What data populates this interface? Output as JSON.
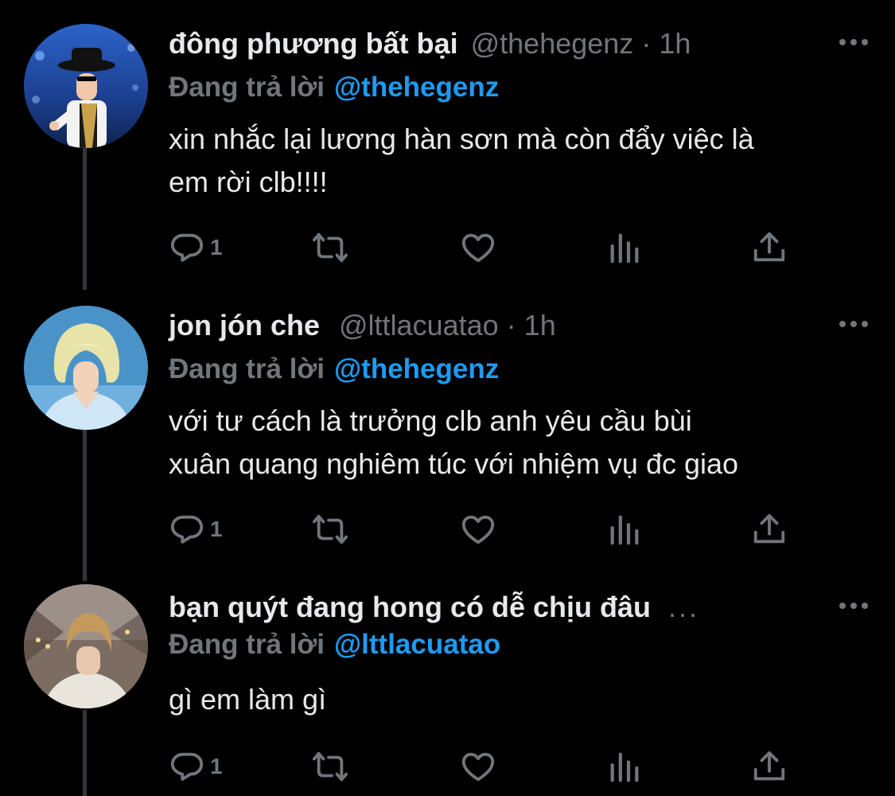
{
  "colors": {
    "background": "#000000",
    "text": "#e7e9ea",
    "muted": "#71767b",
    "accent": "#1d9bf0",
    "thread_line": "#333639"
  },
  "tweets": [
    {
      "name": "đông phương bất bại",
      "name_truncated": false,
      "handle": "@thehegenz",
      "separator": "·",
      "time": "1h",
      "replying_label": "Đang trả lời",
      "replying_to": "@thehegenz",
      "body_lines": [
        "xin nhắc lại lương hàn sơn mà còn đẩy việc là",
        "em rời clb!!!!"
      ],
      "reply_count": "1",
      "avatar_icon": "avatar-blue-stage-performer",
      "more_icon": "more-horizontal-icon"
    },
    {
      "name": "jon jón che",
      "name_truncated": false,
      "handle": "@lttlacuatao",
      "separator": "·",
      "time": "1h",
      "replying_label": "Đang trả lời",
      "replying_to": "@thehegenz",
      "body_lines": [
        "với tư cách là trưởng clb anh yêu cầu bùi",
        "xuân quang nghiêm túc với nhiệm vụ đc giao"
      ],
      "reply_count": "1",
      "avatar_icon": "avatar-blonde-light-blue",
      "more_icon": "more-horizontal-icon"
    },
    {
      "name": "bạn quýt đang hong có dễ chịu đâu",
      "name_truncated": true,
      "name_ellipsis": "...",
      "handle": "",
      "separator": "",
      "time": "",
      "replying_label": "Đang trả lời",
      "replying_to": "@lttlacuatao",
      "body_lines": [
        "gì em làm gì"
      ],
      "reply_count": "1",
      "avatar_icon": "avatar-city-bridge-night",
      "more_icon": "more-horizontal-icon"
    }
  ]
}
